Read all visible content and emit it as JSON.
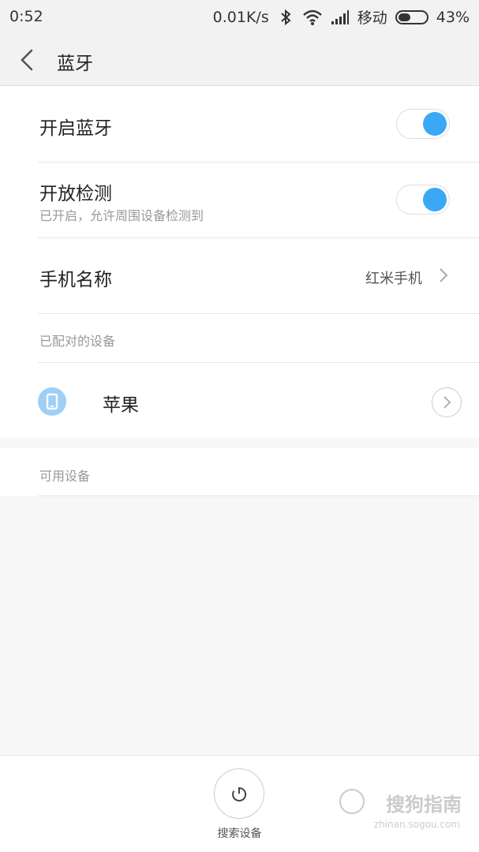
{
  "status_bar": {
    "time": "0:52",
    "net_speed": "0.01K/s",
    "carrier": "移动",
    "battery_percent": "43%",
    "battery_level": 0.43,
    "icons": [
      "bluetooth-icon",
      "wifi-icon",
      "signal-icon",
      "battery-icon"
    ]
  },
  "header": {
    "title": "蓝牙",
    "back_icon": "chevron-left-icon"
  },
  "settings": {
    "bluetooth_toggle": {
      "label": "开启蓝牙",
      "on": true
    },
    "visibility_toggle": {
      "label": "开放检测",
      "subtitle": "已开启，允许周围设备检测到",
      "on": true
    },
    "device_name": {
      "label": "手机名称",
      "value": "红米手机"
    }
  },
  "paired_section": {
    "label": "已配对的设备",
    "devices": [
      {
        "name": "苹果",
        "icon": "phone-icon"
      }
    ]
  },
  "available_section": {
    "label": "可用设备"
  },
  "bottom": {
    "search_label": "搜索设备",
    "search_icon": "refresh-icon"
  },
  "watermark": {
    "text": "搜狗指南",
    "url": "zhinan.sogou.com"
  },
  "colors": {
    "accent": "#3aa8f5",
    "device_icon_bg": "#9ecff5"
  }
}
